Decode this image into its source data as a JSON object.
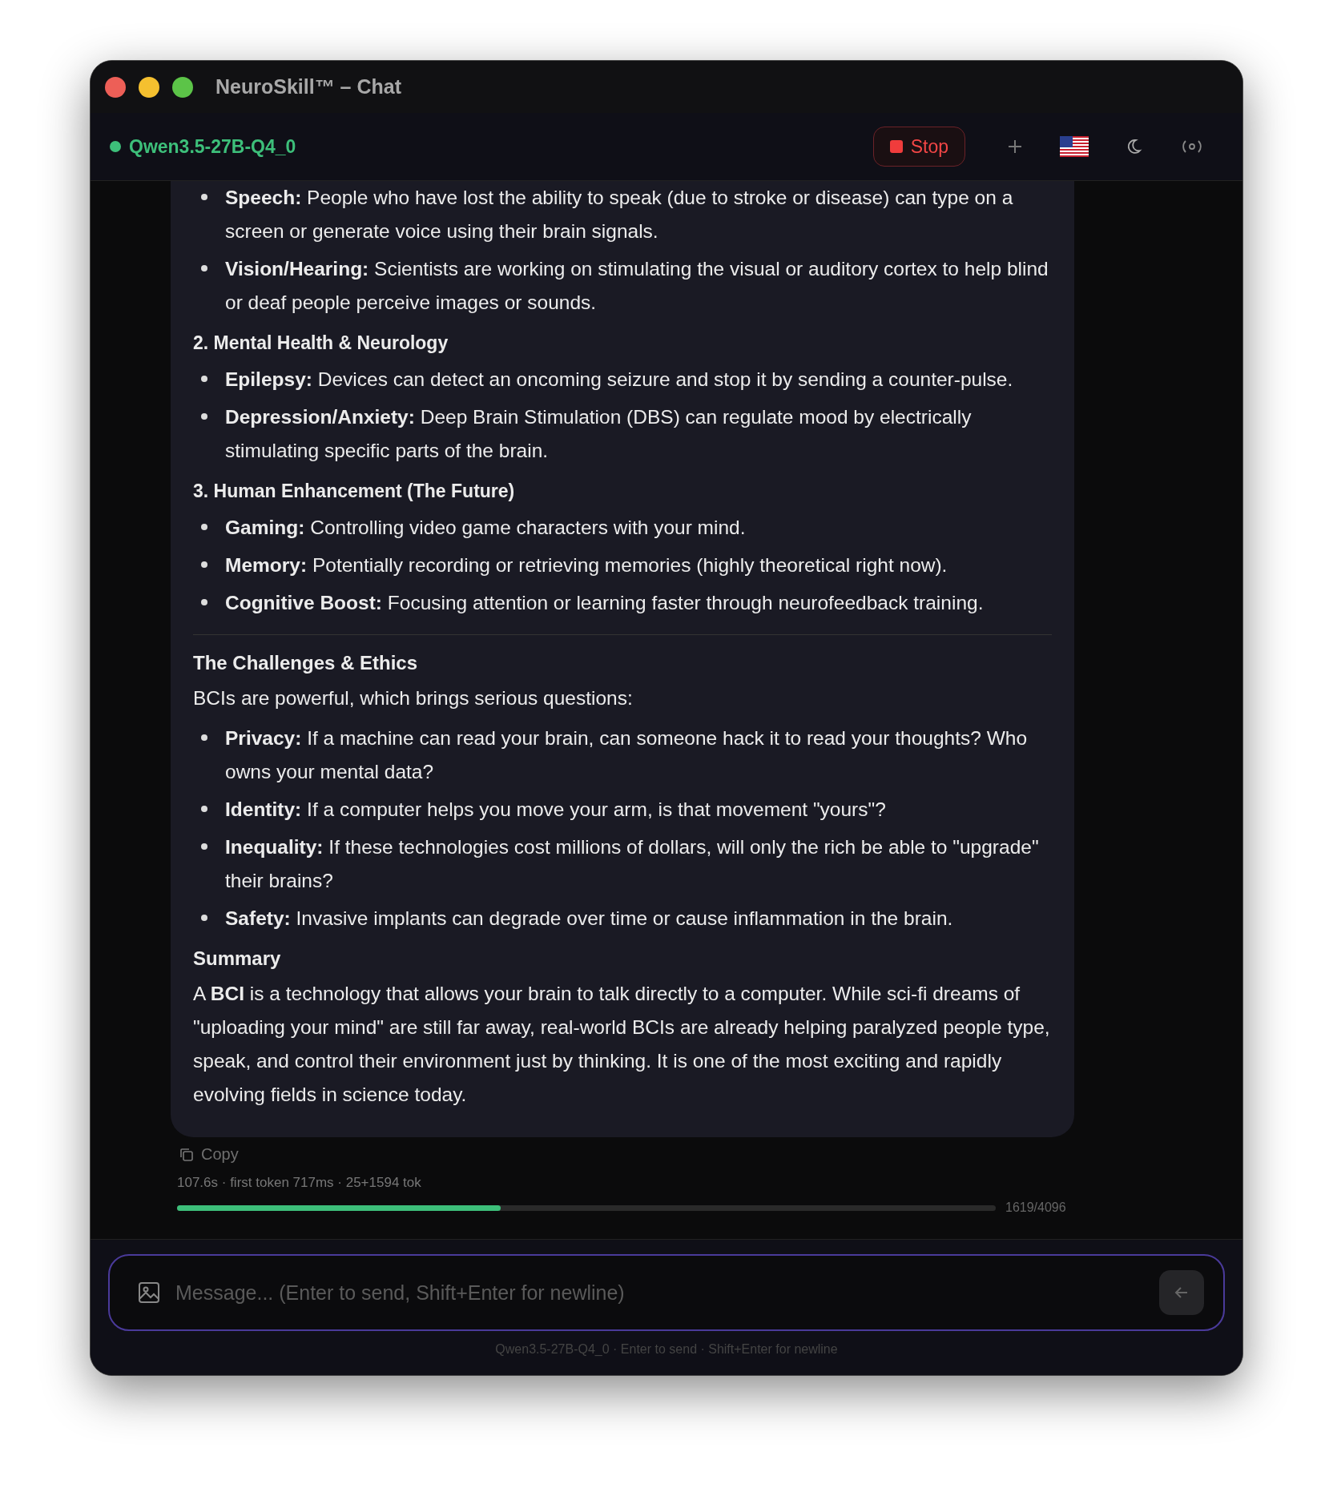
{
  "window": {
    "title": "NeuroSkill™ – Chat"
  },
  "header": {
    "model": "Qwen3.5-27B-Q4_0",
    "online": true,
    "stop_label": "Stop"
  },
  "message": {
    "blocks": [
      {
        "kind": "bullets",
        "items": [
          {
            "term": "Speech:",
            "text": "People who have lost the ability to speak (due to stroke or disease) can type on a screen or generate voice using their brain signals."
          },
          {
            "term": "Vision/Hearing:",
            "text": "Scientists are working on stimulating the visual or auditory cortex to help blind or deaf people perceive images or sounds."
          }
        ]
      },
      {
        "kind": "subheading",
        "text": "2. Mental Health & Neurology"
      },
      {
        "kind": "bullets",
        "items": [
          {
            "term": "Epilepsy:",
            "text": "Devices can detect an oncoming seizure and stop it by sending a counter-pulse."
          },
          {
            "term": "Depression/Anxiety:",
            "text": "Deep Brain Stimulation (DBS) can regulate mood by electrically stimulating specific parts of the brain."
          }
        ]
      },
      {
        "kind": "subheading",
        "text": "3. Human Enhancement (The Future)"
      },
      {
        "kind": "bullets",
        "items": [
          {
            "term": "Gaming:",
            "text": "Controlling video game characters with your mind."
          },
          {
            "term": "Memory:",
            "text": "Potentially recording or retrieving memories (highly theoretical right now)."
          },
          {
            "term": "Cognitive Boost:",
            "text": "Focusing attention or learning faster through neurofeedback training."
          }
        ]
      },
      {
        "kind": "rule"
      },
      {
        "kind": "heading",
        "text": "The Challenges & Ethics"
      },
      {
        "kind": "paragraph",
        "text": "BCIs are powerful, which brings serious questions:"
      },
      {
        "kind": "bullets",
        "items": [
          {
            "term": "Privacy:",
            "text": "If a machine can read your brain, can someone hack it to read your thoughts? Who owns your mental data?"
          },
          {
            "term": "Identity:",
            "text": "If a computer helps you move your arm, is that movement \"yours\"?"
          },
          {
            "term": "Inequality:",
            "text": "If these technologies cost millions of dollars, will only the rich be able to \"upgrade\" their brains?"
          },
          {
            "term": "Safety:",
            "text": "Invasive implants can degrade over time or cause inflammation in the brain."
          }
        ]
      },
      {
        "kind": "heading",
        "text": "Summary"
      },
      {
        "kind": "paragraph",
        "text": "A **BCI** is a technology that allows your brain to talk directly to a computer. While sci-fi dreams of \"uploading your mind\" are still far away, real-world BCIs are already helping paralyzed people type, speak, and control their environment just by thinking. It is one of the most exciting and rapidly evolving fields in science today."
      }
    ]
  },
  "copy_label": "Copy",
  "stats": "107.6s · first token 717ms · 25+1594 tok",
  "context": {
    "level": 0.395,
    "reading": "1619/4096"
  },
  "composer": {
    "placeholder": "Message... (Enter to send, Shift+Enter for newline)",
    "hint": "Qwen3.5-27B-Q4_0 · Enter to send · Shift+Enter for newline"
  }
}
